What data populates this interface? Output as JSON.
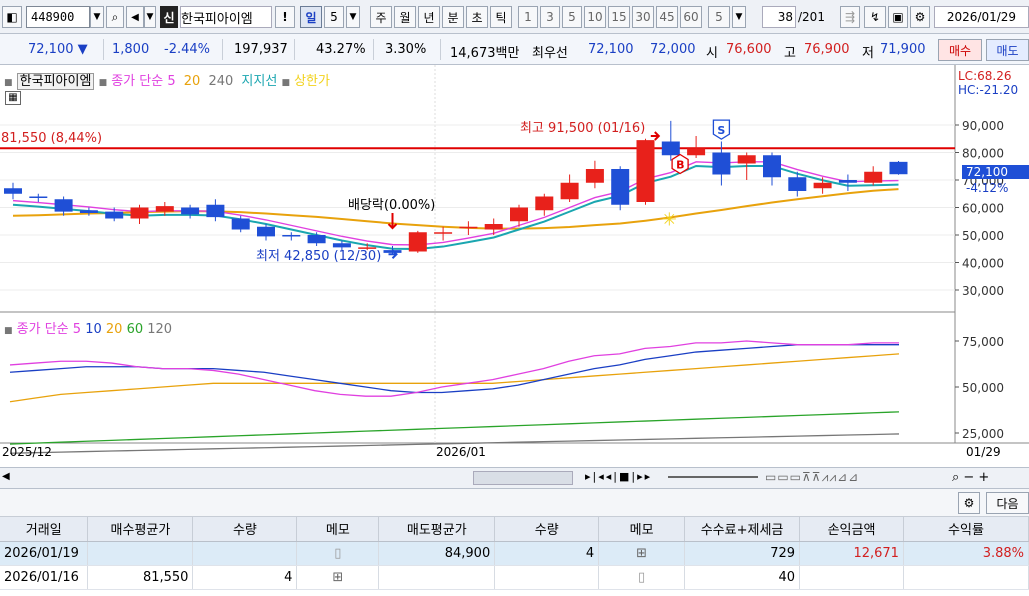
{
  "toolbar": {
    "stock_code": "448900",
    "stock_name": "한국피아이엠",
    "credit_badge": "신",
    "periods": [
      "일",
      "5",
      "주",
      "월",
      "년",
      "분",
      "초",
      "틱"
    ],
    "active_period": "일",
    "intervals": [
      "1",
      "3",
      "5",
      "10",
      "15",
      "30",
      "45",
      "60",
      "5"
    ],
    "page": "38",
    "page_total": "/201",
    "date": "2026/01/29"
  },
  "quote": {
    "price": "72,100 ▼",
    "change": "1,800",
    "rate": "-2.44%",
    "volume": "197,937",
    "turnover_rate": "43.27%",
    "ratio": "3.30%",
    "amount": "14,673백만",
    "priority_label": "최우선",
    "ask": "72,100",
    "bid": "72,000",
    "open_label": "시",
    "open": "76,600",
    "high_label": "고",
    "high": "76,900",
    "low_label": "저",
    "low": "71,900",
    "buy_button": "매수",
    "sell_button": "매도"
  },
  "chart": {
    "legend": {
      "name": "한국피아이엠",
      "ma_label": "종가 단순 5",
      "ma20": "20",
      "ma240": "240",
      "support": "지지선",
      "upper": "상한가"
    },
    "ref_line_label": "81,550 (8,44%)",
    "high_label": "최고 91,500 (01/16)",
    "low_label": "최저 42,850 (12/30)",
    "dividend_label": "배당락(0.00%)",
    "lc_label": "LC:68.26",
    "hc_label": "HC:-21.20",
    "current_price": "72,100",
    "current_pct": "-4.12%",
    "price_ticks": [
      "90,000",
      "80,000",
      "70,000",
      "60,000",
      "50,000",
      "40,000",
      "30,000"
    ],
    "buy_marker": "B",
    "sell_marker": "S",
    "vol_legend": {
      "label": "종가 단순",
      "p5": "5",
      "p10": "10",
      "p20": "20",
      "p60": "60",
      "p120": "120"
    },
    "vol_ticks": [
      "75,000",
      "50,000",
      "25,000"
    ],
    "x_labels": [
      "2025/12",
      "2026/01",
      "01/29"
    ]
  },
  "chart_data": {
    "type": "candlestick",
    "candles": [
      {
        "o": 67,
        "c": 65,
        "h": 69,
        "l": 63
      },
      {
        "o": 64,
        "c": 63.5,
        "h": 65,
        "l": 62
      },
      {
        "o": 63,
        "c": 58.5,
        "h": 64,
        "l": 57
      },
      {
        "o": 59,
        "c": 58,
        "h": 60,
        "l": 57
      },
      {
        "o": 58.5,
        "c": 56,
        "h": 60,
        "l": 55
      },
      {
        "o": 56,
        "c": 60,
        "h": 61,
        "l": 54
      },
      {
        "o": 58.5,
        "c": 60.5,
        "h": 62,
        "l": 57
      },
      {
        "o": 60,
        "c": 57.5,
        "h": 61,
        "l": 56
      },
      {
        "o": 61,
        "c": 56.5,
        "h": 63,
        "l": 55
      },
      {
        "o": 56,
        "c": 52,
        "h": 57,
        "l": 51
      },
      {
        "o": 53,
        "c": 49.5,
        "h": 54,
        "l": 48
      },
      {
        "o": 50,
        "c": 49.5,
        "h": 51,
        "l": 48
      },
      {
        "o": 50,
        "c": 47,
        "h": 51,
        "l": 46
      },
      {
        "o": 47,
        "c": 45.5,
        "h": 48,
        "l": 44.5
      },
      {
        "o": 45.5,
        "c": 45.5,
        "h": 47,
        "l": 44.5
      },
      {
        "o": 44.5,
        "c": 43.5,
        "h": 46,
        "l": 42.85
      },
      {
        "o": 44,
        "c": 51,
        "h": 51.5,
        "l": 43.5
      },
      {
        "o": 51,
        "c": 51,
        "h": 53,
        "l": 48
      },
      {
        "o": 53,
        "c": 53,
        "h": 55,
        "l": 50
      },
      {
        "o": 52,
        "c": 54,
        "h": 56,
        "l": 50
      },
      {
        "o": 55,
        "c": 60,
        "h": 61,
        "l": 53
      },
      {
        "o": 59,
        "c": 64,
        "h": 65,
        "l": 57
      },
      {
        "o": 63,
        "c": 69,
        "h": 72,
        "l": 62
      },
      {
        "o": 69,
        "c": 74,
        "h": 77,
        "l": 67
      },
      {
        "o": 74,
        "c": 61,
        "h": 75,
        "l": 59
      },
      {
        "o": 62,
        "c": 84.5,
        "h": 85,
        "l": 61
      },
      {
        "o": 84,
        "c": 79,
        "h": 91.5,
        "l": 77
      },
      {
        "o": 79,
        "c": 81.5,
        "h": 86,
        "l": 78
      },
      {
        "o": 80,
        "c": 72,
        "h": 84,
        "l": 68
      },
      {
        "o": 76,
        "c": 79,
        "h": 80,
        "l": 70
      },
      {
        "o": 79,
        "c": 71,
        "h": 80,
        "l": 68
      },
      {
        "o": 71,
        "c": 66,
        "h": 73,
        "l": 64
      },
      {
        "o": 67,
        "c": 69,
        "h": 71,
        "l": 65
      },
      {
        "o": 70,
        "c": 69,
        "h": 72,
        "l": 66
      },
      {
        "o": 69,
        "c": 73,
        "h": 75,
        "l": 68
      },
      {
        "o": 76.6,
        "c": 72.1,
        "h": 76.9,
        "l": 71.9
      }
    ],
    "ma5": [
      62.5,
      61.8,
      61,
      60.2,
      59.2,
      58.5,
      58.8,
      58.8,
      58.6,
      57.2,
      55.5,
      53.5,
      51.5,
      49.5,
      47.8,
      46.5,
      46.4,
      47.3,
      48.9,
      50.6,
      53.5,
      56.4,
      60,
      63.6,
      65.8,
      70.4,
      72.7,
      76.6,
      76.2,
      76.6,
      76.6,
      73.8,
      71.4,
      69.4,
      69.6,
      69.8
    ],
    "ma20": [
      57,
      57.2,
      57.5,
      57.8,
      58,
      58.3,
      58.5,
      58.7,
      58.6,
      58.3,
      57.8,
      57.2,
      56.6,
      55.8,
      55,
      54.2,
      53.6,
      53,
      52.6,
      52.3,
      52.3,
      52.5,
      52.9,
      53.6,
      54.2,
      55.2,
      56.4,
      57.8,
      59.1,
      60.5,
      61.8,
      63,
      64.1,
      65.2,
      66.1,
      66.7
    ],
    "resistance": 81.55,
    "vol_ma": {
      "p5": [
        62,
        63,
        64,
        64,
        63,
        61,
        60,
        60,
        59,
        57,
        54,
        51,
        48,
        46,
        45,
        45,
        47,
        50,
        52,
        54,
        57,
        60,
        64,
        67,
        68,
        71,
        72,
        74,
        74,
        75,
        74,
        73,
        73,
        73,
        74,
        74
      ],
      "p10": [
        58,
        59,
        60,
        61,
        61,
        61,
        60,
        60,
        60,
        59,
        58,
        56,
        54,
        52,
        50,
        48,
        47,
        47,
        48,
        49,
        51,
        54,
        57,
        60,
        62,
        65,
        67,
        69,
        70,
        71,
        72,
        73,
        73,
        73,
        73,
        73
      ],
      "p20": [
        42,
        44,
        46,
        47,
        48,
        49,
        50,
        51,
        52,
        52,
        52,
        52,
        52,
        52,
        52,
        52,
        52,
        52,
        52,
        52,
        53,
        54,
        55,
        56,
        57,
        58,
        59,
        60,
        61,
        62,
        63,
        64,
        65,
        66,
        67,
        68
      ],
      "p60": [
        19,
        19.5,
        20,
        20.5,
        21,
        21.5,
        22,
        22.5,
        23,
        23.5,
        24,
        24.5,
        25,
        25.5,
        26,
        26.5,
        27,
        27.5,
        28,
        28.5,
        29,
        29.5,
        30,
        30.5,
        31,
        31.5,
        32,
        32.5,
        33,
        33.5,
        34,
        34.5,
        35,
        35.5,
        36,
        36.5
      ],
      "p120": [
        14,
        14.3,
        14.6,
        14.9,
        15.2,
        15.5,
        15.8,
        16.1,
        16.4,
        16.7,
        17,
        17.3,
        17.6,
        17.9,
        18.2,
        18.5,
        18.8,
        19.1,
        19.4,
        19.7,
        20,
        20.3,
        20.6,
        20.9,
        21.2,
        21.5,
        21.8,
        22.1,
        22.4,
        22.7,
        23,
        23.3,
        23.6,
        23.9,
        24.2,
        24.5
      ]
    }
  },
  "trade_toolbar": {
    "next_button": "다음"
  },
  "table": {
    "headers": [
      "거래일",
      "매수평균가",
      "수량",
      "메모",
      "매도평균가",
      "수량",
      "메모",
      "수수료+제세금",
      "손익금액",
      "수익률"
    ],
    "rows": [
      {
        "date": "2026/01/19",
        "buy_avg": "",
        "buy_qty": "",
        "sell_avg": "84,900",
        "sell_qty": "4",
        "fee": "729",
        "pnl": "12,671",
        "rate": "3.88%"
      },
      {
        "date": "2026/01/16",
        "buy_avg": "81,550",
        "buy_qty": "4",
        "sell_avg": "",
        "sell_qty": "",
        "fee": "40",
        "pnl": "",
        "rate": ""
      }
    ]
  },
  "colors": {
    "up": "#e8211b",
    "down": "#1f4fd6",
    "ma5": "#e040e0",
    "ma20": "#e8a20c",
    "ma5b": "#1aa6b0",
    "line_red": "#e00000"
  }
}
